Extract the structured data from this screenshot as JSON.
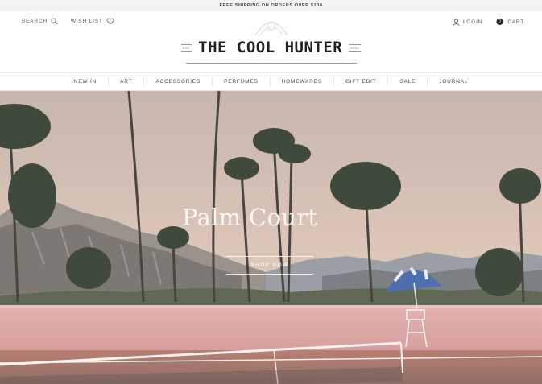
{
  "announcement": "FREE SHIPPING ON ORDERS OVER $100",
  "utility": {
    "search_label": "SEARCH",
    "wishlist_label": "WISH LIST",
    "login_label": "LOGIN",
    "cart_label": "CART",
    "cart_count": "0"
  },
  "logo": {
    "title": "THE COOL HUNTER"
  },
  "nav": {
    "items": [
      {
        "label": "NEW IN"
      },
      {
        "label": "ART"
      },
      {
        "label": "ACCESSORIES"
      },
      {
        "label": "PERFUMES"
      },
      {
        "label": "HOMEWARES"
      },
      {
        "label": "GIFT EDIT"
      },
      {
        "label": "SALE"
      },
      {
        "label": "JOURNAL"
      }
    ]
  },
  "hero": {
    "title": "Palm Court",
    "cta_label": "SHOP NOW"
  },
  "colors": {
    "sky": "#d8c2b6",
    "wall": "#dcaaa7",
    "court": "#c98d7e",
    "umbrella": "#4f6fb0"
  }
}
